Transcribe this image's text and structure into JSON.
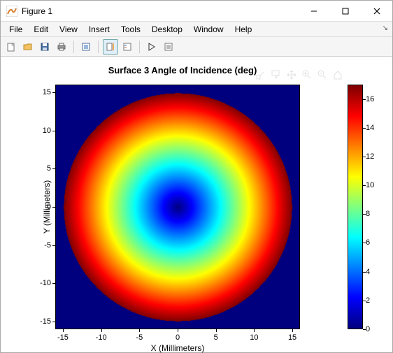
{
  "window": {
    "title": "Figure 1"
  },
  "menu": {
    "items": [
      "File",
      "Edit",
      "View",
      "Insert",
      "Tools",
      "Desktop",
      "Window",
      "Help"
    ]
  },
  "chart_data": {
    "type": "heatmap",
    "title": "Surface 3 Angle of Incidence (deg)",
    "xlabel": "X (Millimeters)",
    "ylabel": "Y (Millimeters)",
    "xlim": [
      -16,
      16
    ],
    "ylim": [
      -16,
      16
    ],
    "xticks": [
      -15,
      -10,
      -5,
      0,
      5,
      10,
      15
    ],
    "yticks": [
      -15,
      -10,
      -5,
      0,
      5,
      10,
      15
    ],
    "colorbar": {
      "ticks": [
        0,
        2,
        4,
        6,
        8,
        10,
        12,
        14,
        16
      ],
      "lim": [
        0,
        17
      ]
    },
    "description": "Radially symmetric map: value ~ 0 at center (0,0) rising to ~17 at radius 15 mm; circular aperture of radius ~15 on dark-blue background",
    "colormap": "jet"
  }
}
